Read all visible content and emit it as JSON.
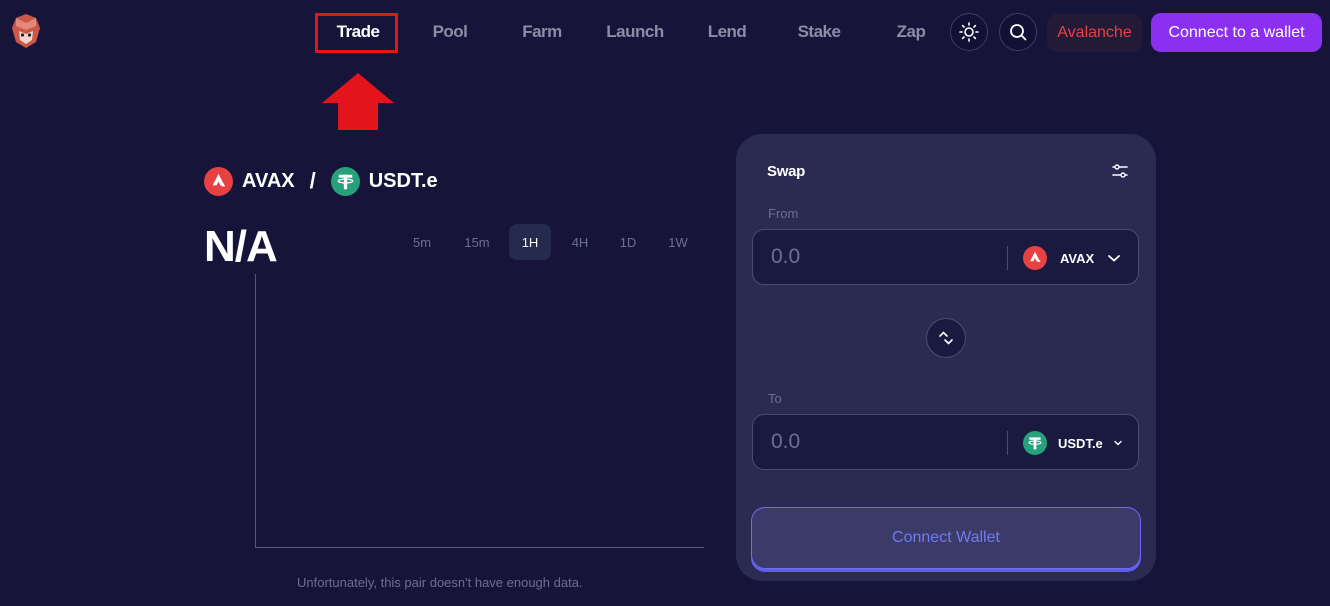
{
  "nav": {
    "items": [
      "Trade",
      "Pool",
      "Farm",
      "Launch",
      "Lend",
      "Stake",
      "Zap"
    ],
    "active": "Trade",
    "network_label": "Avalanche",
    "connect_label": "Connect to a wallet"
  },
  "icons": {
    "logo": "fox-logo",
    "theme": "sun-icon",
    "search": "search-icon"
  },
  "pair": {
    "base": "AVAX",
    "separator": "/",
    "quote": "USDT.e",
    "price": "N/A"
  },
  "timeframes": {
    "options": [
      "5m",
      "15m",
      "1H",
      "4H",
      "1D",
      "1W"
    ],
    "selected": "1H"
  },
  "chart": {
    "no_data_message": "Unfortunately, this pair doesn't have enough data."
  },
  "swap": {
    "title": "Swap",
    "from": {
      "label": "From",
      "placeholder": "0.0",
      "token": "AVAX"
    },
    "to": {
      "label": "To",
      "placeholder": "0.0",
      "token": "USDT.e"
    },
    "connect_label": "Connect Wallet"
  },
  "colors": {
    "background": "#161539",
    "panel": "#2b2a52",
    "accent": "#8b2ff0",
    "avax_red": "#e84142",
    "usdt_green": "#26a17b",
    "highlight_red": "#e3141c"
  }
}
